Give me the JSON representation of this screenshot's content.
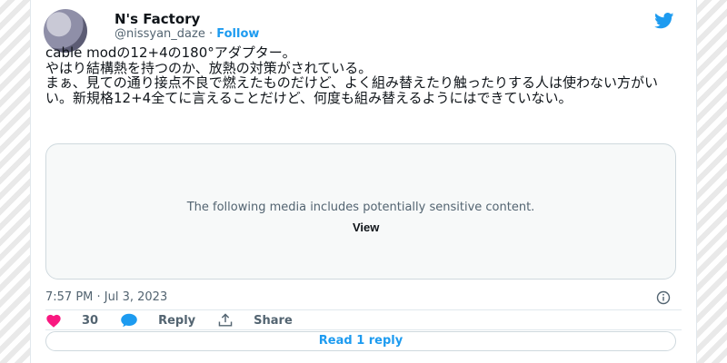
{
  "author": {
    "display_name": "N's Factory",
    "handle": "@nissyan_daze",
    "separator": " · ",
    "follow_label": "Follow"
  },
  "tweet": {
    "text_line1": "cable modの12+4の180°アダプター。",
    "text_line2": "やはり結構熱を持つのか、放熱の対策がされている。",
    "text_line3": "まぁ、見ての通り接点不良で燃えたものだけど、よく組み替えたり触ったりする人は使わない方がいい。新規格12+4全てに言えることだけど、何度も組み替えるようにはできていない。"
  },
  "media": {
    "notice": "The following media includes potentially sensitive content.",
    "view_label": "View"
  },
  "meta": {
    "timestamp": "7:57 PM · Jul 3, 2023"
  },
  "actions": {
    "like_count": "30",
    "reply_label": "Reply",
    "share_label": "Share"
  },
  "read_replies_label": "Read 1 reply",
  "colors": {
    "twitter_blue": "#1d9bf0",
    "like_pink": "#f91880"
  },
  "icons": [
    "twitter-bird-icon",
    "info-icon",
    "heart-icon",
    "reply-bubble-icon",
    "share-icon"
  ]
}
